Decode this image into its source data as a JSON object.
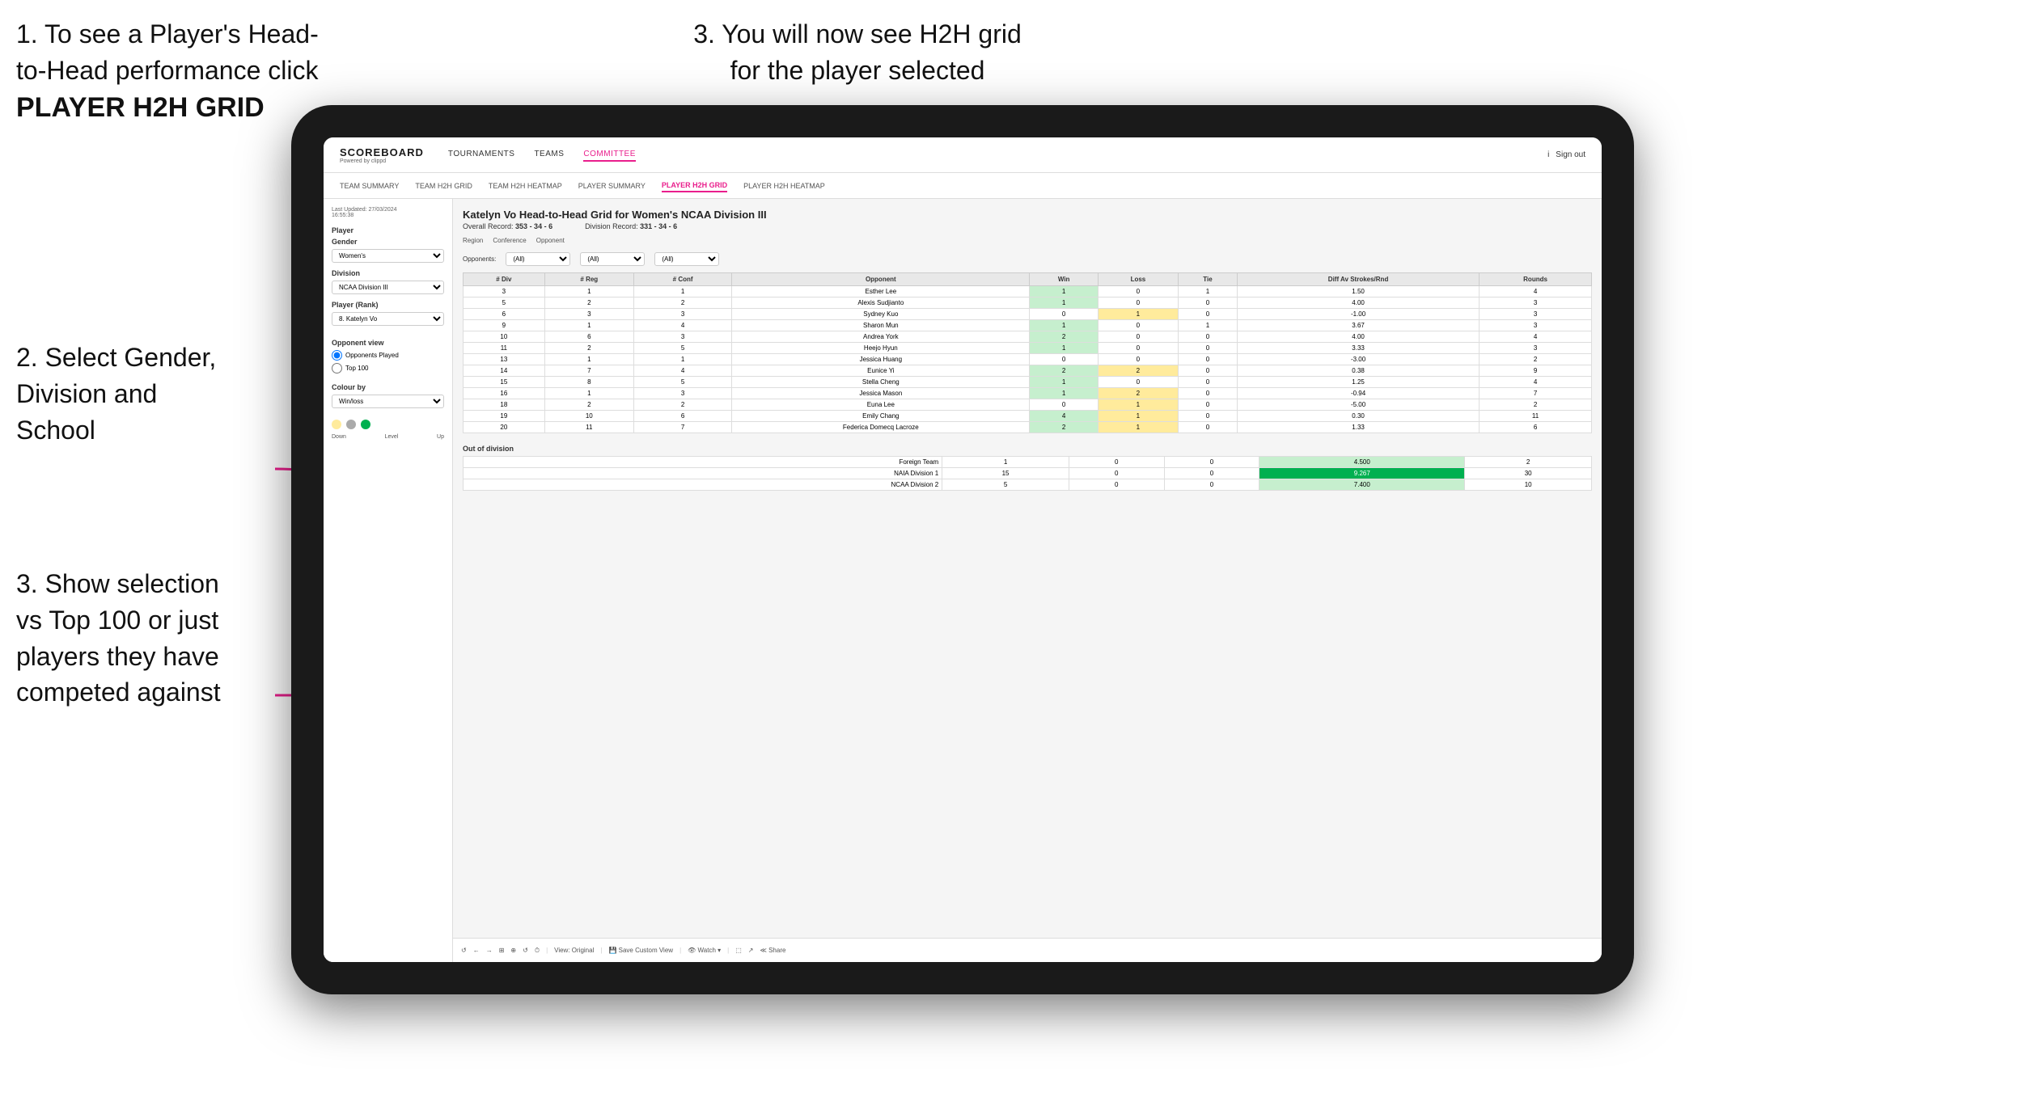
{
  "instructions": {
    "top_left_line1": "1. To see a Player's Head-",
    "top_left_line2": "to-Head performance click",
    "top_left_bold": "PLAYER H2H GRID",
    "top_right": "3. You will now see H2H grid\nfor the player selected",
    "mid_left_line1": "2. Select Gender,",
    "mid_left_line2": "Division and",
    "mid_left_line3": "School",
    "bot_left_line1": "3. Show selection",
    "bot_left_line2": "vs Top 100 or just",
    "bot_left_line3": "players they have",
    "bot_left_line4": "competed against"
  },
  "header": {
    "logo": "SCOREBOARD",
    "logo_sub": "Powered by clippd",
    "nav_items": [
      "TOURNAMENTS",
      "TEAMS",
      "COMMITTEE"
    ],
    "header_right_items": [
      "i",
      "Sign out"
    ]
  },
  "sub_nav": {
    "items": [
      "TEAM SUMMARY",
      "TEAM H2H GRID",
      "TEAM H2H HEATMAP",
      "PLAYER SUMMARY",
      "PLAYER H2H GRID",
      "PLAYER H2H HEATMAP"
    ]
  },
  "left_panel": {
    "timestamp_label": "Last Updated: 27/03/2024",
    "timestamp_time": "16:55:38",
    "player_label": "Player",
    "gender_label": "Gender",
    "gender_value": "Women's",
    "division_label": "Division",
    "division_value": "NCAA Division III",
    "player_rank_label": "Player (Rank)",
    "player_rank_value": "8. Katelyn Vo",
    "opponent_view_label": "Opponent view",
    "radio_opponents": "Opponents Played",
    "radio_top100": "Top 100",
    "colour_by_label": "Colour by",
    "colour_value": "Win/loss",
    "colour_down": "Down",
    "colour_level": "Level",
    "colour_up": "Up"
  },
  "grid": {
    "title": "Katelyn Vo Head-to-Head Grid for Women's NCAA Division III",
    "overall_record_label": "Overall Record:",
    "overall_record_value": "353 - 34 - 6",
    "division_record_label": "Division Record:",
    "division_record_value": "331 - 34 - 6",
    "region_label": "Region",
    "conference_label": "Conference",
    "opponent_label": "Opponent",
    "opponents_label": "Opponents:",
    "opponents_filter": "(All)",
    "conference_filter": "(All)",
    "opponent_filter": "(All)",
    "col_headers": [
      "# Div",
      "# Reg",
      "# Conf",
      "Opponent",
      "Win",
      "Loss",
      "Tie",
      "Diff Av Strokes/Rnd",
      "Rounds"
    ],
    "rows": [
      {
        "div": "3",
        "reg": "1",
        "conf": "1",
        "opponent": "Esther Lee",
        "win": "1",
        "loss": "0",
        "tie": "1",
        "diff": "1.50",
        "rounds": "4",
        "color": "yellow"
      },
      {
        "div": "5",
        "reg": "2",
        "conf": "2",
        "opponent": "Alexis Sudjianto",
        "win": "1",
        "loss": "0",
        "tie": "0",
        "diff": "4.00",
        "rounds": "3",
        "color": "green"
      },
      {
        "div": "6",
        "reg": "3",
        "conf": "3",
        "opponent": "Sydney Kuo",
        "win": "0",
        "loss": "1",
        "tie": "0",
        "diff": "-1.00",
        "rounds": "3",
        "color": "white"
      },
      {
        "div": "9",
        "reg": "1",
        "conf": "4",
        "opponent": "Sharon Mun",
        "win": "1",
        "loss": "0",
        "tie": "1",
        "diff": "3.67",
        "rounds": "3",
        "color": "yellow"
      },
      {
        "div": "10",
        "reg": "6",
        "conf": "3",
        "opponent": "Andrea York",
        "win": "2",
        "loss": "0",
        "tie": "0",
        "diff": "4.00",
        "rounds": "4",
        "color": "green"
      },
      {
        "div": "11",
        "reg": "2",
        "conf": "5",
        "opponent": "Heejo Hyun",
        "win": "1",
        "loss": "0",
        "tie": "0",
        "diff": "3.33",
        "rounds": "3",
        "color": "green"
      },
      {
        "div": "13",
        "reg": "1",
        "conf": "1",
        "opponent": "Jessica Huang",
        "win": "0",
        "loss": "0",
        "tie": "0",
        "diff": "-3.00",
        "rounds": "2",
        "color": "white"
      },
      {
        "div": "14",
        "reg": "7",
        "conf": "4",
        "opponent": "Eunice Yi",
        "win": "2",
        "loss": "2",
        "tie": "0",
        "diff": "0.38",
        "rounds": "9",
        "color": "yellow"
      },
      {
        "div": "15",
        "reg": "8",
        "conf": "5",
        "opponent": "Stella Cheng",
        "win": "1",
        "loss": "0",
        "tie": "0",
        "diff": "1.25",
        "rounds": "4",
        "color": "green"
      },
      {
        "div": "16",
        "reg": "1",
        "conf": "3",
        "opponent": "Jessica Mason",
        "win": "1",
        "loss": "2",
        "tie": "0",
        "diff": "-0.94",
        "rounds": "7",
        "color": "white"
      },
      {
        "div": "18",
        "reg": "2",
        "conf": "2",
        "opponent": "Euna Lee",
        "win": "0",
        "loss": "1",
        "tie": "0",
        "diff": "-5.00",
        "rounds": "2",
        "color": "white"
      },
      {
        "div": "19",
        "reg": "10",
        "conf": "6",
        "opponent": "Emily Chang",
        "win": "4",
        "loss": "1",
        "tie": "0",
        "diff": "0.30",
        "rounds": "11",
        "color": "green"
      },
      {
        "div": "20",
        "reg": "11",
        "conf": "7",
        "opponent": "Federica Domecq Lacroze",
        "win": "2",
        "loss": "1",
        "tie": "0",
        "diff": "1.33",
        "rounds": "6",
        "color": "green"
      }
    ],
    "out_of_division_label": "Out of division",
    "out_of_div_rows": [
      {
        "label": "Foreign Team",
        "win": "1",
        "loss": "0",
        "tie": "0",
        "diff": "4.500",
        "rounds": "2",
        "color": "green_mid"
      },
      {
        "label": "NAIA Division 1",
        "win": "15",
        "loss": "0",
        "tie": "0",
        "diff": "9.267",
        "rounds": "30",
        "color": "green_dark"
      },
      {
        "label": "NCAA Division 2",
        "win": "5",
        "loss": "0",
        "tie": "0",
        "diff": "7.400",
        "rounds": "10",
        "color": "green_mid"
      }
    ]
  },
  "toolbar": {
    "items": [
      "↺",
      "←",
      "→",
      "⊞",
      "⊕",
      "↺",
      "⏱",
      "|",
      "View: Original",
      "|",
      "Save Custom View",
      "|",
      "👁 Watch ▾",
      "|",
      "⬚",
      "↗",
      "≪ Share"
    ]
  }
}
